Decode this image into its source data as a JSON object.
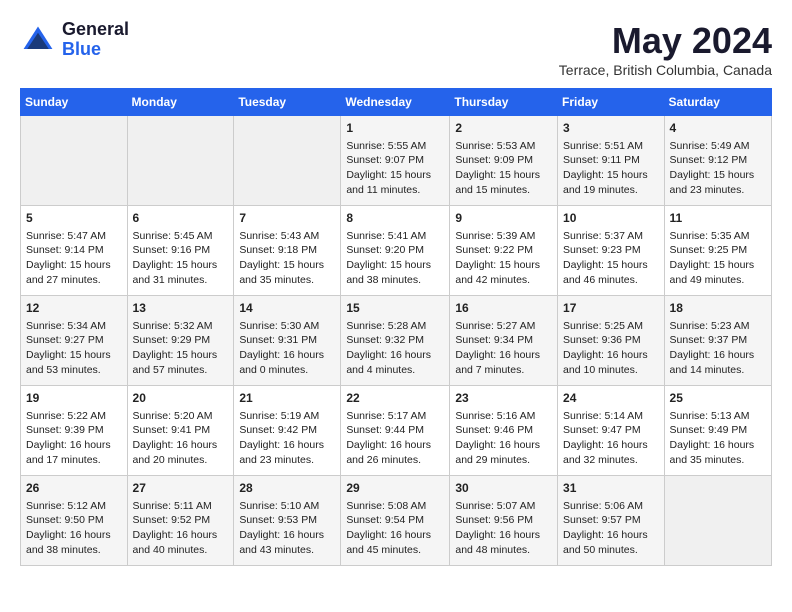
{
  "logo": {
    "general": "General",
    "blue": "Blue"
  },
  "title": "May 2024",
  "location": "Terrace, British Columbia, Canada",
  "days_of_week": [
    "Sunday",
    "Monday",
    "Tuesday",
    "Wednesday",
    "Thursday",
    "Friday",
    "Saturday"
  ],
  "weeks": [
    [
      {
        "day": "",
        "info": ""
      },
      {
        "day": "",
        "info": ""
      },
      {
        "day": "",
        "info": ""
      },
      {
        "day": "1",
        "info": "Sunrise: 5:55 AM\nSunset: 9:07 PM\nDaylight: 15 hours\nand 11 minutes."
      },
      {
        "day": "2",
        "info": "Sunrise: 5:53 AM\nSunset: 9:09 PM\nDaylight: 15 hours\nand 15 minutes."
      },
      {
        "day": "3",
        "info": "Sunrise: 5:51 AM\nSunset: 9:11 PM\nDaylight: 15 hours\nand 19 minutes."
      },
      {
        "day": "4",
        "info": "Sunrise: 5:49 AM\nSunset: 9:12 PM\nDaylight: 15 hours\nand 23 minutes."
      }
    ],
    [
      {
        "day": "5",
        "info": "Sunrise: 5:47 AM\nSunset: 9:14 PM\nDaylight: 15 hours\nand 27 minutes."
      },
      {
        "day": "6",
        "info": "Sunrise: 5:45 AM\nSunset: 9:16 PM\nDaylight: 15 hours\nand 31 minutes."
      },
      {
        "day": "7",
        "info": "Sunrise: 5:43 AM\nSunset: 9:18 PM\nDaylight: 15 hours\nand 35 minutes."
      },
      {
        "day": "8",
        "info": "Sunrise: 5:41 AM\nSunset: 9:20 PM\nDaylight: 15 hours\nand 38 minutes."
      },
      {
        "day": "9",
        "info": "Sunrise: 5:39 AM\nSunset: 9:22 PM\nDaylight: 15 hours\nand 42 minutes."
      },
      {
        "day": "10",
        "info": "Sunrise: 5:37 AM\nSunset: 9:23 PM\nDaylight: 15 hours\nand 46 minutes."
      },
      {
        "day": "11",
        "info": "Sunrise: 5:35 AM\nSunset: 9:25 PM\nDaylight: 15 hours\nand 49 minutes."
      }
    ],
    [
      {
        "day": "12",
        "info": "Sunrise: 5:34 AM\nSunset: 9:27 PM\nDaylight: 15 hours\nand 53 minutes."
      },
      {
        "day": "13",
        "info": "Sunrise: 5:32 AM\nSunset: 9:29 PM\nDaylight: 15 hours\nand 57 minutes."
      },
      {
        "day": "14",
        "info": "Sunrise: 5:30 AM\nSunset: 9:31 PM\nDaylight: 16 hours\nand 0 minutes."
      },
      {
        "day": "15",
        "info": "Sunrise: 5:28 AM\nSunset: 9:32 PM\nDaylight: 16 hours\nand 4 minutes."
      },
      {
        "day": "16",
        "info": "Sunrise: 5:27 AM\nSunset: 9:34 PM\nDaylight: 16 hours\nand 7 minutes."
      },
      {
        "day": "17",
        "info": "Sunrise: 5:25 AM\nSunset: 9:36 PM\nDaylight: 16 hours\nand 10 minutes."
      },
      {
        "day": "18",
        "info": "Sunrise: 5:23 AM\nSunset: 9:37 PM\nDaylight: 16 hours\nand 14 minutes."
      }
    ],
    [
      {
        "day": "19",
        "info": "Sunrise: 5:22 AM\nSunset: 9:39 PM\nDaylight: 16 hours\nand 17 minutes."
      },
      {
        "day": "20",
        "info": "Sunrise: 5:20 AM\nSunset: 9:41 PM\nDaylight: 16 hours\nand 20 minutes."
      },
      {
        "day": "21",
        "info": "Sunrise: 5:19 AM\nSunset: 9:42 PM\nDaylight: 16 hours\nand 23 minutes."
      },
      {
        "day": "22",
        "info": "Sunrise: 5:17 AM\nSunset: 9:44 PM\nDaylight: 16 hours\nand 26 minutes."
      },
      {
        "day": "23",
        "info": "Sunrise: 5:16 AM\nSunset: 9:46 PM\nDaylight: 16 hours\nand 29 minutes."
      },
      {
        "day": "24",
        "info": "Sunrise: 5:14 AM\nSunset: 9:47 PM\nDaylight: 16 hours\nand 32 minutes."
      },
      {
        "day": "25",
        "info": "Sunrise: 5:13 AM\nSunset: 9:49 PM\nDaylight: 16 hours\nand 35 minutes."
      }
    ],
    [
      {
        "day": "26",
        "info": "Sunrise: 5:12 AM\nSunset: 9:50 PM\nDaylight: 16 hours\nand 38 minutes."
      },
      {
        "day": "27",
        "info": "Sunrise: 5:11 AM\nSunset: 9:52 PM\nDaylight: 16 hours\nand 40 minutes."
      },
      {
        "day": "28",
        "info": "Sunrise: 5:10 AM\nSunset: 9:53 PM\nDaylight: 16 hours\nand 43 minutes."
      },
      {
        "day": "29",
        "info": "Sunrise: 5:08 AM\nSunset: 9:54 PM\nDaylight: 16 hours\nand 45 minutes."
      },
      {
        "day": "30",
        "info": "Sunrise: 5:07 AM\nSunset: 9:56 PM\nDaylight: 16 hours\nand 48 minutes."
      },
      {
        "day": "31",
        "info": "Sunrise: 5:06 AM\nSunset: 9:57 PM\nDaylight: 16 hours\nand 50 minutes."
      },
      {
        "day": "",
        "info": ""
      }
    ]
  ]
}
